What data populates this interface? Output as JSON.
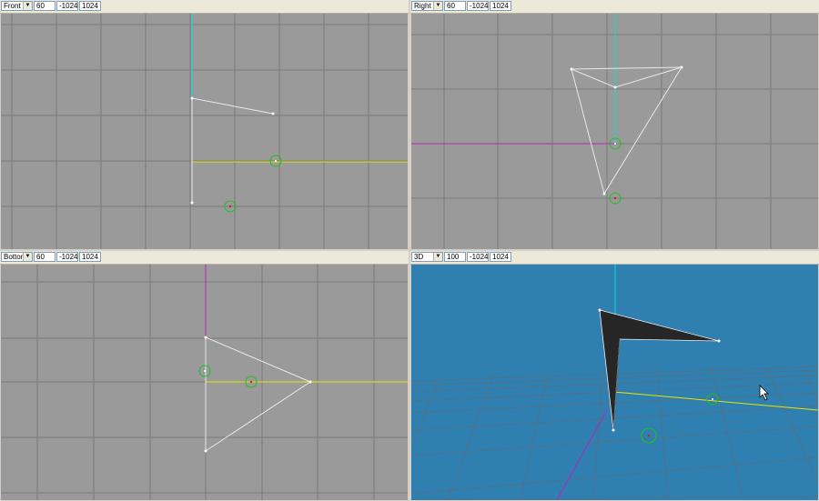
{
  "viewports": [
    {
      "name": "Front",
      "zoom": "60",
      "min": "-1024",
      "max": "1024"
    },
    {
      "name": "Right",
      "zoom": "60",
      "min": "-1024",
      "max": "1024"
    },
    {
      "name": "Bottom",
      "zoom": "60",
      "min": "-1024",
      "max": "1024"
    },
    {
      "name": "3D",
      "zoom": "100",
      "min": "-1024",
      "max": "1024"
    }
  ],
  "colors": {
    "viewport_bg_2d": "#9a9a9a",
    "viewport_bg_3d": "#2f7fb1",
    "axis_x": "#e6e600",
    "axis_y": "#00e0e0",
    "axis_z": "#c020c0",
    "selection_ring": "#20c020",
    "pivot_dot": "#d02020",
    "wireframe": "#e8e8e8"
  },
  "icons": {
    "dropdown_arrow": "chevron-down-icon",
    "cursor": "mouse-cursor-icon"
  }
}
